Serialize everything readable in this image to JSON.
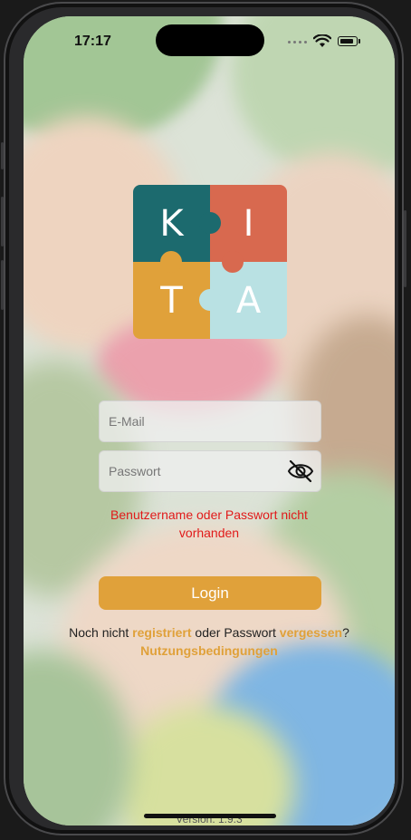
{
  "status_bar": {
    "time": "17:17"
  },
  "logo": {
    "letters": [
      "K",
      "I",
      "T",
      "A"
    ]
  },
  "login": {
    "email_placeholder": "E-Mail",
    "password_placeholder": "Passwort",
    "error_message": "Benutzername oder Passwort nicht vorhanden",
    "login_label": "Login"
  },
  "footer": {
    "prefix": "Noch nicht",
    "register_link": "registriert",
    "middle": "oder Passwort",
    "forgot_link": "vergessen",
    "suffix": "?",
    "terms_link": "Nutzungsbedingungen",
    "version": "Version: 1.9.3"
  },
  "colors": {
    "accent": "#e0a13a",
    "error": "#e11a1a",
    "logo_teal": "#1c6a6e",
    "logo_coral": "#d8694f",
    "logo_ochre": "#e0a13a",
    "logo_light_blue": "#b9e1e3"
  }
}
